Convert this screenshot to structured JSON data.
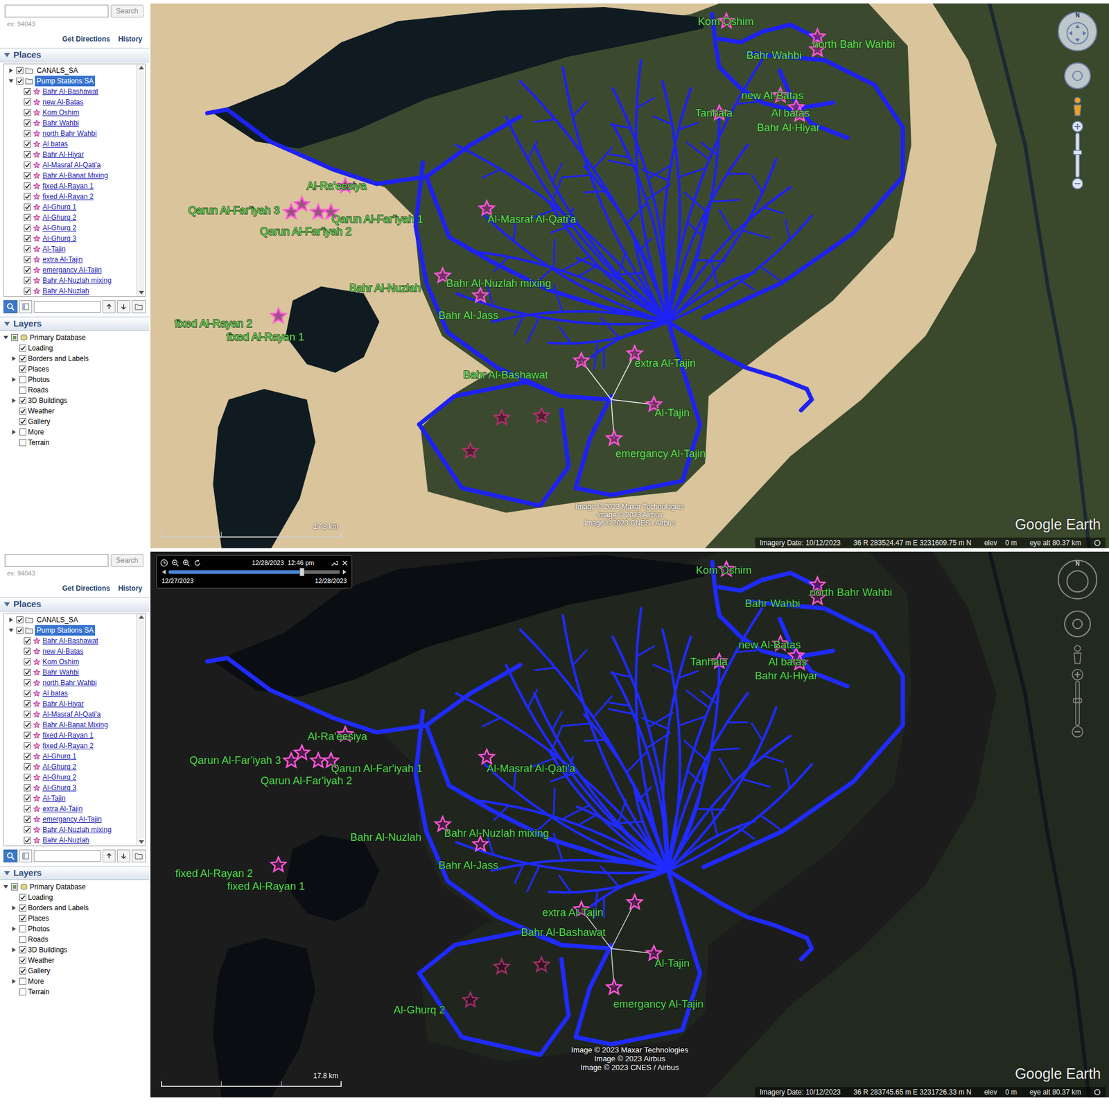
{
  "panels": [
    {
      "kind": "day",
      "sidebar": {
        "search": {
          "button": "Search",
          "hint": "ex: 94043"
        },
        "links": [
          "Get Directions",
          "History"
        ],
        "places": {
          "title": "Places",
          "expanded": true,
          "folders": [
            {
              "label": "CANALS_SA",
              "checked": true,
              "expanded": false,
              "selected": false
            },
            {
              "label": "Pump Stations SA",
              "checked": true,
              "expanded": true,
              "selected": true
            }
          ],
          "items": [
            {
              "label": "Bahr Al-Bashawat",
              "checked": true
            },
            {
              "label": "new Al-Batas",
              "checked": true
            },
            {
              "label": "Kom Oshim",
              "checked": true
            },
            {
              "label": "Bahr Wahbi",
              "checked": true
            },
            {
              "label": "north Bahr Wahbi",
              "checked": true
            },
            {
              "label": "Al batas",
              "checked": true
            },
            {
              "label": "Bahr Al-Hiyar",
              "checked": true
            },
            {
              "label": "Al-Masraf Al-Qati'a",
              "checked": true
            },
            {
              "label": "Bahr Al-Banat Mixing",
              "checked": true
            },
            {
              "label": "fixed Al-Rayan 1",
              "checked": true
            },
            {
              "label": "fixed Al-Rayan 2",
              "checked": true
            },
            {
              "label": "Al-Ghurq 1",
              "checked": true
            },
            {
              "label": "Al-Ghurq 2",
              "checked": true
            },
            {
              "label": "Al-Ghurq 2",
              "checked": true
            },
            {
              "label": "Al-Ghurq 3",
              "checked": true
            },
            {
              "label": "Al-Tajin",
              "checked": true
            },
            {
              "label": "extra Al-Tajin",
              "checked": true
            },
            {
              "label": "emergancy Al-Tajin",
              "checked": true
            },
            {
              "label": "Bahr Al-Nuzlah mixing",
              "checked": true
            },
            {
              "label": "Bahr Al-Nuzlah",
              "checked": true
            }
          ]
        },
        "layers": {
          "title": "Layers",
          "expanded": true,
          "items": [
            {
              "label": "Primary Database",
              "checked": true,
              "partial": true,
              "expanded": true,
              "children": [
                {
                  "label": "Loading",
                  "checked": true
                },
                {
                  "label": "Borders and Labels",
                  "checked": true,
                  "expanded": false
                },
                {
                  "label": "Places",
                  "checked": true
                },
                {
                  "label": "Photos",
                  "checked": false,
                  "expanded": false
                },
                {
                  "label": "Roads",
                  "checked": false
                },
                {
                  "label": "3D Buildings",
                  "checked": true,
                  "expanded": false
                },
                {
                  "label": "Weather",
                  "checked": true
                },
                {
                  "label": "Gallery",
                  "checked": true
                },
                {
                  "label": "More",
                  "checked": false,
                  "expanded": false
                },
                {
                  "label": "Terrain",
                  "checked": false
                }
              ]
            }
          ]
        }
      },
      "map": {
        "compass": "N",
        "markers": [
          {
            "label": "Kom Oshim"
          },
          {
            "label": "north Bahr Wahbi"
          },
          {
            "label": "Bahr Wahbi"
          },
          {
            "label": "new Al-Batas"
          },
          {
            "label": "Tanhala"
          },
          {
            "label": "Al batas"
          },
          {
            "label": "Bahr Al-Hiyar"
          },
          {
            "label": "Al-Ra'eesiya"
          },
          {
            "label": "Qarun Al-Far'iyah 3"
          },
          {
            "label": "Qarun Al-Far'iyah 1"
          },
          {
            "label": "Qarun Al-Far'iyah 2"
          },
          {
            "label": "Al-Masraf Al-Qati'a"
          },
          {
            "label": "Bahr Al-Nuzlah"
          },
          {
            "label": "Bahr Al-Nuzlah mixing"
          },
          {
            "label": "Bahr Al-Jass"
          },
          {
            "label": "fixed Al-Rayan 2"
          },
          {
            "label": "fixed Al-Rayan 1"
          },
          {
            "label": "extra Al-Tajin"
          },
          {
            "label": "Bahr Al-Bashawat"
          },
          {
            "label": "Al-Tajin"
          },
          {
            "label": "emergancy Al-Tajin"
          }
        ],
        "scale": "17.8 km",
        "attribution": [
          "Image © 2023 Maxar Technologies",
          "Image © 2023 Airbus",
          "Image © 2023 CNES / Airbus"
        ],
        "logo": "Google Earth"
      },
      "status_bar": {
        "imagery_date": "Imagery Date: 10/12/2023",
        "coords": "36 R 283524.47 m E 3231609.75 m N",
        "elev_label": "elev",
        "elev": "0 m",
        "eye_alt": "eye alt 80.37 km"
      }
    },
    {
      "kind": "night",
      "sidebar": {
        "search": {
          "button": "Search",
          "hint": "ex: 94043"
        },
        "links": [
          "Get Directions",
          "History"
        ],
        "places": {
          "title": "Places",
          "expanded": true,
          "folders": [
            {
              "label": "CANALS_SA",
              "checked": true,
              "expanded": false,
              "selected": false
            },
            {
              "label": "Pump Stations SA",
              "checked": true,
              "expanded": true,
              "selected": true
            }
          ],
          "items": [
            {
              "label": "Bahr Al-Bashawat",
              "checked": true
            },
            {
              "label": "new Al-Batas",
              "checked": true
            },
            {
              "label": "Kom Oshim",
              "checked": true
            },
            {
              "label": "Bahr Wahbi",
              "checked": true
            },
            {
              "label": "north Bahr Wahbi",
              "checked": true
            },
            {
              "label": "Al batas",
              "checked": true
            },
            {
              "label": "Bahr Al-Hiyar",
              "checked": true
            },
            {
              "label": "Al-Masraf Al-Qati'a",
              "checked": true
            },
            {
              "label": "Bahr Al-Banat Mixing",
              "checked": true
            },
            {
              "label": "fixed Al-Rayan 1",
              "checked": true
            },
            {
              "label": "fixed Al-Rayan 2",
              "checked": true
            },
            {
              "label": "Al-Ghurq 1",
              "checked": true
            },
            {
              "label": "Al-Ghurq 2",
              "checked": true
            },
            {
              "label": "Al-Ghurq 2",
              "checked": true
            },
            {
              "label": "Al-Ghurq 3",
              "checked": true
            },
            {
              "label": "Al-Tajin",
              "checked": true
            },
            {
              "label": "extra Al-Tajin",
              "checked": true
            },
            {
              "label": "emergancy Al-Tajin",
              "checked": true
            },
            {
              "label": "Bahr Al-Nuzlah mixing",
              "checked": true
            },
            {
              "label": "Bahr Al-Nuzlah",
              "checked": true
            }
          ]
        },
        "layers": {
          "title": "Layers",
          "expanded": true,
          "items": [
            {
              "label": "Primary Database",
              "checked": true,
              "partial": true,
              "expanded": true,
              "children": [
                {
                  "label": "Loading",
                  "checked": true
                },
                {
                  "label": "Borders and Labels",
                  "checked": true,
                  "expanded": false
                },
                {
                  "label": "Places",
                  "checked": true
                },
                {
                  "label": "Photos",
                  "checked": false,
                  "expanded": false
                },
                {
                  "label": "Roads",
                  "checked": false
                },
                {
                  "label": "3D Buildings",
                  "checked": true,
                  "expanded": false
                },
                {
                  "label": "Weather",
                  "checked": true
                },
                {
                  "label": "Gallery",
                  "checked": true
                },
                {
                  "label": "More",
                  "checked": false,
                  "expanded": false
                },
                {
                  "label": "Terrain",
                  "checked": false
                }
              ]
            }
          ]
        }
      },
      "map": {
        "compass": "N",
        "time_slider": {
          "current": "12/28/2023  12:46 pm",
          "start": "12/27/2023",
          "end": "12/28/2023",
          "level": 0.78
        },
        "markers": [
          {
            "label": "Kom Oshim"
          },
          {
            "label": "north Bahr Wahbi"
          },
          {
            "label": "Bahr Wahbi"
          },
          {
            "label": "new Al-Batas"
          },
          {
            "label": "Tanhala"
          },
          {
            "label": "Al batas"
          },
          {
            "label": "Bahr Al-Hiyar"
          },
          {
            "label": "Al-Ra'eesiya"
          },
          {
            "label": "Qarun Al-Far'iyah 3"
          },
          {
            "label": "Qarun Al-Far'iyah 1"
          },
          {
            "label": "Qarun Al-Far'iyah 2"
          },
          {
            "label": "Al-Masraf Al-Qati'a"
          },
          {
            "label": "Bahr Al-Nuzlah"
          },
          {
            "label": "Bahr Al-Nuzlah mixing"
          },
          {
            "label": "Bahr Al-Jass"
          },
          {
            "label": "fixed Al-Rayan 2"
          },
          {
            "label": "fixed Al-Rayan 1"
          },
          {
            "label": "extra Al-Tajin"
          },
          {
            "label": "Bahr Al-Bashawat"
          },
          {
            "label": "Al-Tajin"
          },
          {
            "label": "emergancy Al-Tajin"
          },
          {
            "label": "Al-Ghurq 2"
          }
        ],
        "scale": "17.8 km",
        "attribution": [
          "Image © 2023 Maxar Technologies",
          "Image © 2023 Airbus",
          "Image © 2023 CNES / Airbus"
        ],
        "logo": "Google Earth"
      },
      "status_bar": {
        "imagery_date": "Imagery Date: 10/12/2023",
        "coords": "36 R 283745.65 m E 3231726.33 m N",
        "elev_label": "elev",
        "elev": "0 m",
        "eye_alt": "eye alt 80.37 km"
      }
    }
  ]
}
